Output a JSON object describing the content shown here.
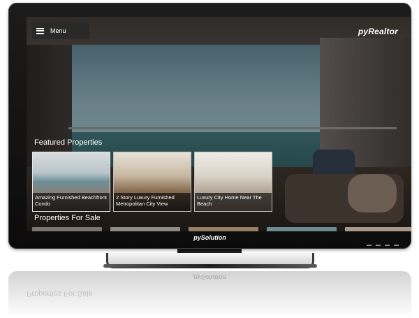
{
  "header": {
    "menu_label": "Menu",
    "logo_text": "pyRealtor"
  },
  "featured": {
    "title": "Featured Properties",
    "cards": [
      {
        "caption": "Amazing Furnished Beachfront Condo"
      },
      {
        "caption": "2 Story Luxury Furnished Metropolitan City View"
      },
      {
        "caption": "Luxury City Home Near The Beach"
      }
    ]
  },
  "for_sale": {
    "title": "Properties For Sale"
  },
  "device": {
    "brand": "pySolution"
  },
  "colors": {
    "overlay": "#000000",
    "text": "#ffffff",
    "bezel": "#111111",
    "selected_border": "#e6e6e6"
  }
}
